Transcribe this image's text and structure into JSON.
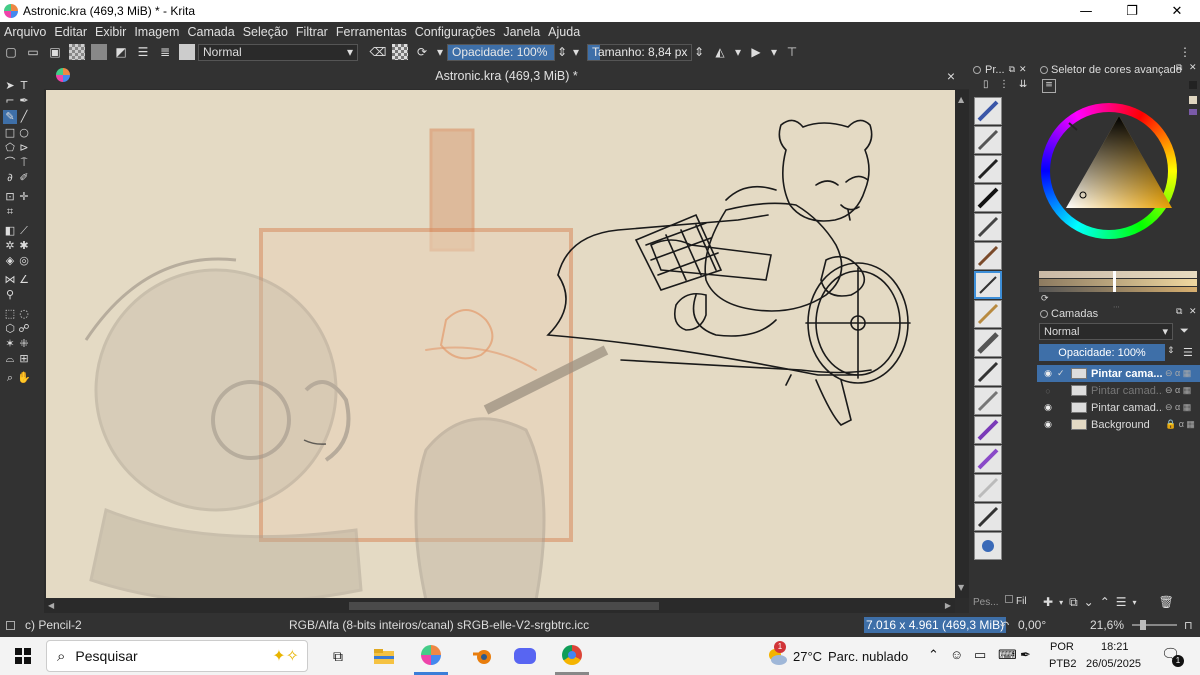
{
  "window": {
    "title": "Astronic.kra (469,3 MiB) * - Krita",
    "minimize": "—",
    "maximize": "❐",
    "close": "✕"
  },
  "menu": [
    "Arquivo",
    "Editar",
    "Exibir",
    "Imagem",
    "Camada",
    "Seleção",
    "Filtrar",
    "Ferramentas",
    "Configurações",
    "Janela",
    "Ajuda"
  ],
  "toolbar": {
    "blend_mode": "Normal",
    "opacity_label": "Opacidade: 100%",
    "opacity_fraction": 1.0,
    "size_label": "Tamanho: 8,84 px",
    "size_fraction": 0.12
  },
  "document": {
    "tab_title": "Astronic.kra (469,3 MiB) *",
    "close": "×"
  },
  "panels": {
    "brush_presets_title": "Pr...",
    "color_selector_title": "Seletor de cores avançado",
    "layers_title": "Camadas",
    "layers_blend": "Normal",
    "layers_opacity": "Opacidade:  100%",
    "brush_search_placeholder": "Pes...",
    "filter_label": "Fil"
  },
  "layers": [
    {
      "name": "Pintar cama...",
      "visible": true,
      "selected": true
    },
    {
      "name": "Pintar camad...",
      "visible": false,
      "selected": false
    },
    {
      "name": "Pintar camad...",
      "visible": true,
      "selected": false
    },
    {
      "name": "Background",
      "visible": true,
      "selected": false
    }
  ],
  "status": {
    "brush": "c) Pencil-2",
    "color_space": "RGB/Alfa (8-bits inteiros/canal)  sRGB-elle-V2-srgbtrc.icc",
    "dimensions": "7.016 x 4.961 (469,3 MiB)",
    "rotation": "0,00°",
    "zoom": "21,6%"
  },
  "taskbar": {
    "search_placeholder": "Pesquisar",
    "weather_temp": "27°C",
    "weather_desc": "Parc. nublado",
    "lang_top": "POR",
    "lang_bottom": "PTB2",
    "time": "18:21",
    "date": "26/05/2025",
    "notif_count": "1",
    "task_badge": "1"
  },
  "colors": {
    "canvas": "#e4dac4",
    "sketch_orange": "#e39a6c",
    "sketch_gray": "#a89e90",
    "accent": "#3e6fa8"
  }
}
